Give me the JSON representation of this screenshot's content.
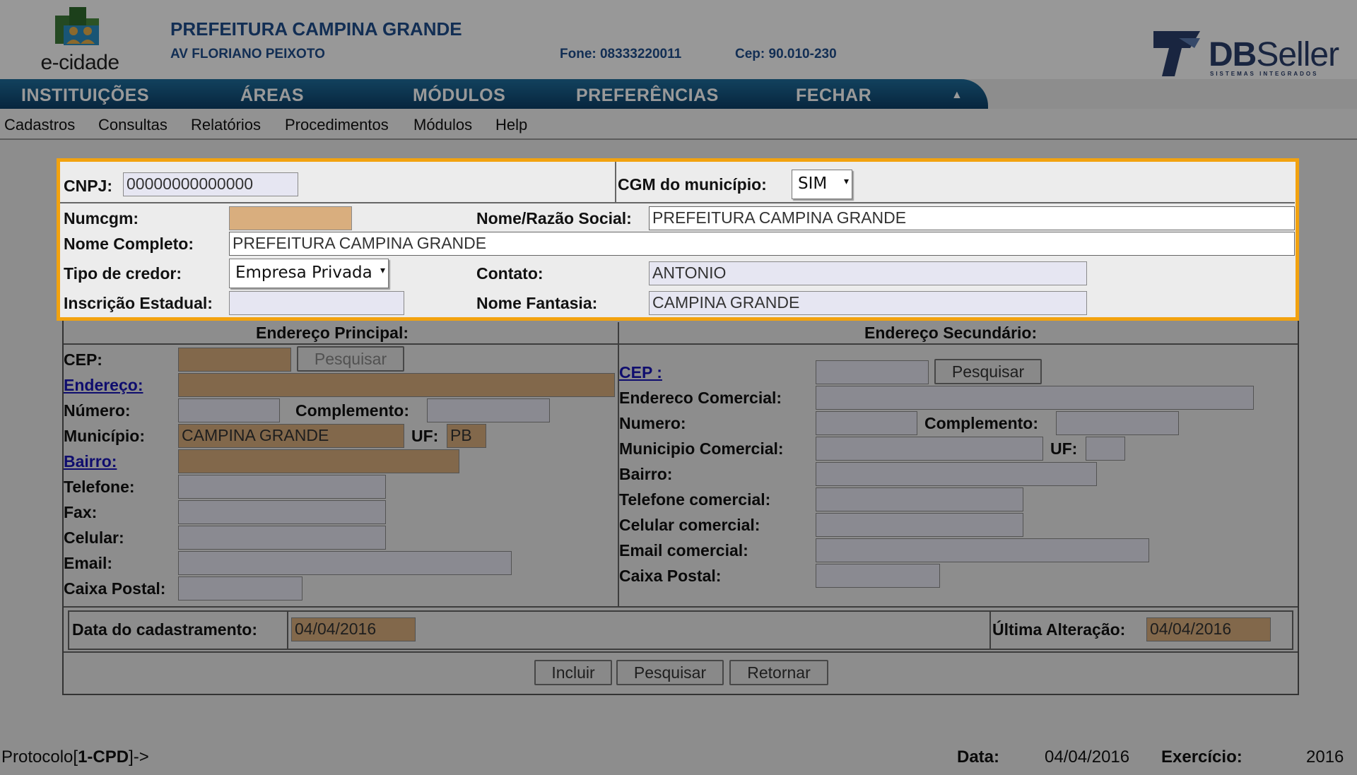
{
  "header": {
    "logo_text": "e-cidade",
    "org_name": "PREFEITURA CAMPINA GRANDE",
    "org_address": "AV FLORIANO PEIXOTO",
    "fone": "Fone: 08333220011",
    "cep": "Cep: 90.010-230",
    "vendor_logo_main": "DB",
    "vendor_logo_rest": "Seller",
    "vendor_tagline": "SISTEMAS INTEGRADOS"
  },
  "nav": {
    "items": [
      "INSTITUIÇÕES",
      "ÁREAS",
      "MÓDULOS",
      "PREFERÊNCIAS",
      "FECHAR"
    ],
    "collapse_icon": "triangle-up-icon"
  },
  "menu": {
    "items": [
      "Cadastros",
      "Consultas",
      "Relatórios",
      "Procedimentos",
      "Módulos",
      "Help"
    ]
  },
  "form": {
    "cnpj_label": "CNPJ:",
    "cnpj_value": "00000000000000",
    "cgm_label": "CGM do município:",
    "cgm_value": "SIM",
    "numcgm_label": "Numcgm:",
    "numcgm_value": "",
    "razao_label": "Nome/Razão Social:",
    "razao_value": "PREFEITURA CAMPINA GRANDE",
    "nome_completo_label": "Nome Completo:",
    "nome_completo_value": "PREFEITURA CAMPINA GRANDE",
    "tipo_credor_label": "Tipo de credor:",
    "tipo_credor_value": "Empresa Privada",
    "contato_label": "Contato:",
    "contato_value": "ANTONIO",
    "inscricao_label": "Inscrição Estadual:",
    "inscricao_value": "",
    "fantasia_label": "Nome Fantasia:",
    "fantasia_value": "CAMPINA GRANDE",
    "principal": {
      "title": "Endereço Principal:",
      "cep_label": "CEP:",
      "pesquisar_label": "Pesquisar",
      "endereco_label": "Endereço:",
      "numero_label": "Número:",
      "complemento_label": "Complemento:",
      "municipio_label": "Município:",
      "municipio_value": "CAMPINA GRANDE",
      "uf_label": "UF:",
      "uf_value": "PB",
      "bairro_label": "Bairro:",
      "telefone_label": "Telefone:",
      "fax_label": "Fax:",
      "celular_label": "Celular:",
      "email_label": "Email:",
      "caixa_label": "Caixa Postal:"
    },
    "secundario": {
      "title": "Endereço Secundário:",
      "cep_label": "CEP :",
      "pesquisar_label": "Pesquisar",
      "endereco_label": "Endereco Comercial:",
      "numero_label": "Numero:",
      "complemento_label": "Complemento:",
      "municipio_label": "Municipio Comercial:",
      "uf_label": "UF:",
      "bairro_label": "Bairro:",
      "telefone_label": "Telefone comercial:",
      "celular_label": "Celular comercial:",
      "email_label": "Email comercial:",
      "caixa_label": "Caixa Postal:"
    },
    "data_cad_label": "Data do cadastramento:",
    "data_cad_value": "04/04/2016",
    "ultima_label": "Última Alteração:",
    "ultima_value": "04/04/2016",
    "buttons": {
      "incluir": "Incluir",
      "pesquisar": "Pesquisar",
      "retornar": "Retornar"
    }
  },
  "footer": {
    "protocolo_prefix": "Protocolo[",
    "protocolo_bold": "1-CPD",
    "protocolo_suffix": "]->",
    "data_label": "Data:",
    "data_value": "04/04/2016",
    "exercicio_label": "Exercício:",
    "exercicio_value": "2016"
  },
  "colors": {
    "highlight": "#f2a20f",
    "nav_bg": "#0c3f68",
    "title_blue": "#1f4e8c",
    "required_field": "#d9ae7e",
    "link": "#1a16b8"
  }
}
